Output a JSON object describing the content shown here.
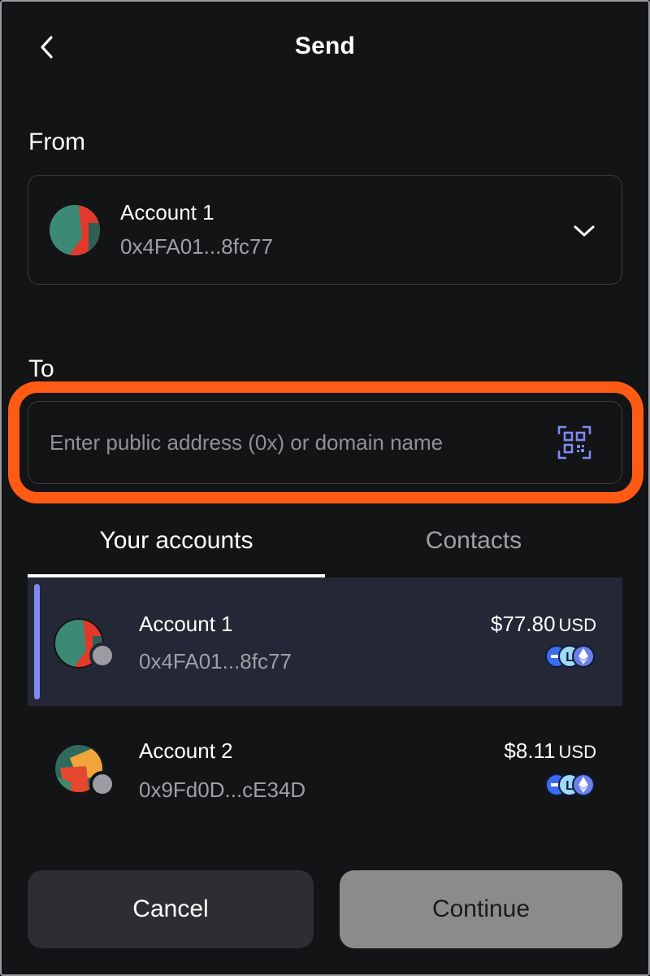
{
  "header": {
    "title": "Send",
    "back_icon": "chevron-left-icon"
  },
  "from": {
    "label": "From",
    "account_name": "Account 1",
    "account_address": "0x4FA01...8fc77",
    "dropdown_icon": "chevron-down-icon"
  },
  "to": {
    "label": "To",
    "value": "",
    "placeholder": "Enter public address (0x) or domain name",
    "scan_icon": "qr-scan-icon",
    "highlight_color": "#ff5b14"
  },
  "tabs": [
    {
      "label": "Your accounts",
      "active": true
    },
    {
      "label": "Contacts",
      "active": false
    }
  ],
  "accounts": [
    {
      "name": "Account 1",
      "address": "0x4FA01...8fc77",
      "balance": "$77.80",
      "currency": "USD",
      "selected": true
    },
    {
      "name": "Account 2",
      "address": "0x9Fd0D...cE34D",
      "balance": "$8.11",
      "currency": "USD",
      "selected": false
    }
  ],
  "actions": {
    "cancel_label": "Cancel",
    "continue_label": "Continue"
  },
  "colors": {
    "background": "#131416",
    "selected_row": "#242736",
    "accent": "#7f89f0",
    "highlight": "#ff5b14"
  }
}
